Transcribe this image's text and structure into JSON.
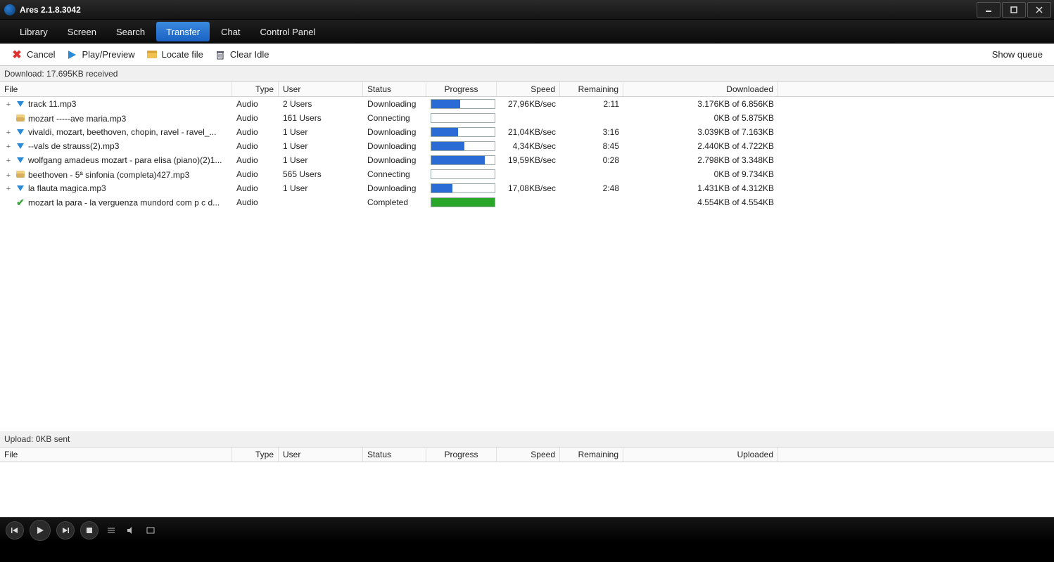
{
  "window": {
    "title": "Ares 2.1.8.3042"
  },
  "nav": {
    "tabs": [
      {
        "label": "Library",
        "active": false
      },
      {
        "label": "Screen",
        "active": false
      },
      {
        "label": "Search",
        "active": false
      },
      {
        "label": "Transfer",
        "active": true
      },
      {
        "label": "Chat",
        "active": false
      },
      {
        "label": "Control Panel",
        "active": false
      }
    ]
  },
  "toolbar": {
    "cancel": "Cancel",
    "play_preview": "Play/Preview",
    "locate_file": "Locate file",
    "clear_idle": "Clear Idle",
    "show_queue": "Show queue"
  },
  "download": {
    "summary": "Download: 17.695KB received",
    "columns": {
      "file": "File",
      "type": "Type",
      "user": "User",
      "status": "Status",
      "progress": "Progress",
      "speed": "Speed",
      "remaining": "Remaining",
      "downloaded": "Downloaded"
    },
    "rows": [
      {
        "expand": true,
        "icon": "downloading",
        "file": "track 11.mp3",
        "type": "Audio",
        "user": "2 Users",
        "status": "Downloading",
        "progress": 46,
        "speed": "27,96KB/sec",
        "remaining": "2:11",
        "downloaded": "3.176KB of 6.856KB"
      },
      {
        "expand": false,
        "icon": "connecting",
        "file": "mozart -----ave maria.mp3",
        "type": "Audio",
        "user": "161 Users",
        "status": "Connecting",
        "progress": 0,
        "speed": "",
        "remaining": "",
        "downloaded": "0KB of 5.875KB"
      },
      {
        "expand": true,
        "icon": "downloading",
        "file": "vivaldi, mozart, beethoven, chopin, ravel - ravel_...",
        "type": "Audio",
        "user": "1 User",
        "status": "Downloading",
        "progress": 42,
        "speed": "21,04KB/sec",
        "remaining": "3:16",
        "downloaded": "3.039KB of 7.163KB"
      },
      {
        "expand": true,
        "icon": "downloading",
        "file": "--vals de strauss(2).mp3",
        "type": "Audio",
        "user": "1 User",
        "status": "Downloading",
        "progress": 52,
        "speed": "4,34KB/sec",
        "remaining": "8:45",
        "downloaded": "2.440KB of 4.722KB"
      },
      {
        "expand": true,
        "icon": "downloading",
        "file": "wolfgang amadeus mozart - para elisa (piano)(2)1...",
        "type": "Audio",
        "user": "1 User",
        "status": "Downloading",
        "progress": 84,
        "speed": "19,59KB/sec",
        "remaining": "0:28",
        "downloaded": "2.798KB of 3.348KB"
      },
      {
        "expand": true,
        "icon": "connecting",
        "file": "beethoven - 5ª sinfonia (completa)427.mp3",
        "type": "Audio",
        "user": "565 Users",
        "status": "Connecting",
        "progress": 0,
        "speed": "",
        "remaining": "",
        "downloaded": "0KB of 9.734KB"
      },
      {
        "expand": true,
        "icon": "downloading",
        "file": "la flauta magica.mp3",
        "type": "Audio",
        "user": "1 User",
        "status": "Downloading",
        "progress": 33,
        "speed": "17,08KB/sec",
        "remaining": "2:48",
        "downloaded": "1.431KB of 4.312KB"
      },
      {
        "expand": false,
        "icon": "completed",
        "file": "mozart la para - la verguenza mundord com p c d...",
        "type": "Audio",
        "user": "",
        "status": "Completed",
        "progress": 100,
        "speed": "",
        "remaining": "",
        "downloaded": "4.554KB of 4.554KB"
      }
    ]
  },
  "upload": {
    "summary": "Upload: 0KB sent",
    "columns": {
      "file": "File",
      "type": "Type",
      "user": "User",
      "status": "Status",
      "progress": "Progress",
      "speed": "Speed",
      "remaining": "Remaining",
      "uploaded": "Uploaded"
    },
    "rows": []
  }
}
